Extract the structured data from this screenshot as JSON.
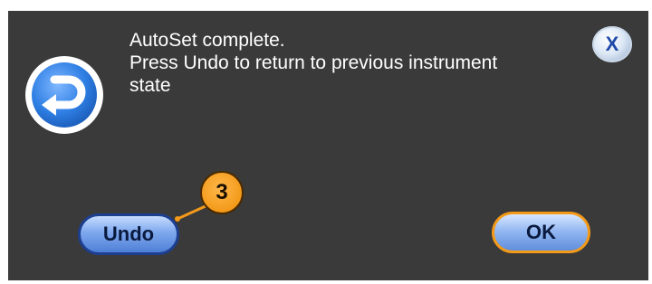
{
  "dialog": {
    "message_line1": "AutoSet complete.",
    "message_line2": "Press Undo to return to previous instrument",
    "message_line3": "state",
    "close_label": "X",
    "undo_label": "Undo",
    "ok_label": "OK",
    "callout_number": "3"
  },
  "icons": {
    "undo": "undo-arrow-icon",
    "close": "close-x-icon"
  },
  "colors": {
    "dialog_background": "#3a3a3a",
    "button_blue": "#7ea8ee",
    "callout_orange": "#f39a1a",
    "ok_border": "#f39a18"
  }
}
